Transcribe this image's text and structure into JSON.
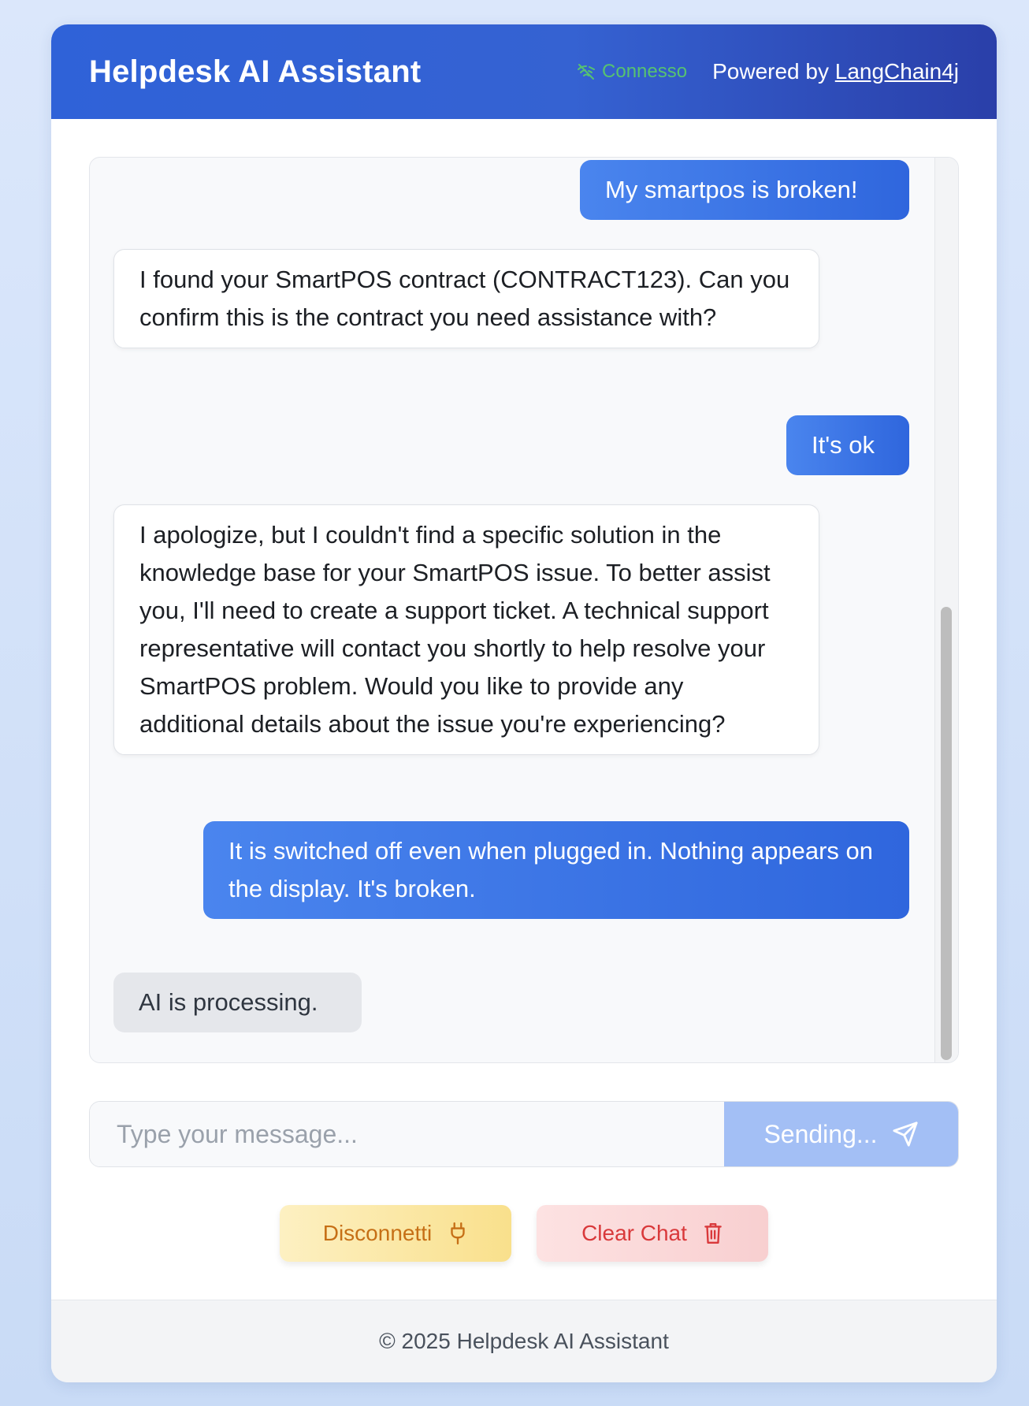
{
  "header": {
    "title": "Helpdesk AI Assistant",
    "status_label": "Connesso",
    "status_color": "#56c271",
    "powered_prefix": "Powered by",
    "powered_link": "LangChain4j"
  },
  "chat": {
    "messages": [
      {
        "role": "user",
        "text": "My smartpos is broken!"
      },
      {
        "role": "assistant",
        "text": "I found your SmartPOS contract (CONTRACT123). Can you confirm this is the contract you need assistance with?"
      },
      {
        "role": "user",
        "text": "It's ok"
      },
      {
        "role": "assistant",
        "text": "I apologize, but I couldn't find a specific solution in the knowledge base for your SmartPOS issue. To better assist you, I'll need to create a support ticket. A technical support representative will contact you shortly to help resolve your SmartPOS problem. Would you like to provide any additional details about the issue you're experiencing?"
      },
      {
        "role": "user",
        "text": "It is switched off even when plugged in. Nothing appears on the display. It's broken."
      }
    ],
    "typing_indicator": "AI is processing."
  },
  "composer": {
    "placeholder": "Type your message...",
    "value": "",
    "send_label": "Sending...",
    "send_icon": "send-icon"
  },
  "actions": {
    "disconnect_label": "Disconnetti",
    "disconnect_icon": "plug-icon",
    "clear_label": "Clear Chat",
    "clear_icon": "trash-icon"
  },
  "footer": {
    "copyright": "© 2025 Helpdesk AI Assistant"
  },
  "colors": {
    "header_gradient_start": "#2f62d8",
    "header_gradient_end": "#2a3fa9",
    "user_bubble": "#3a72e4",
    "send_disabled": "#a3bff5",
    "disconnect_text": "#c66f16",
    "clear_text": "#d9393b"
  }
}
